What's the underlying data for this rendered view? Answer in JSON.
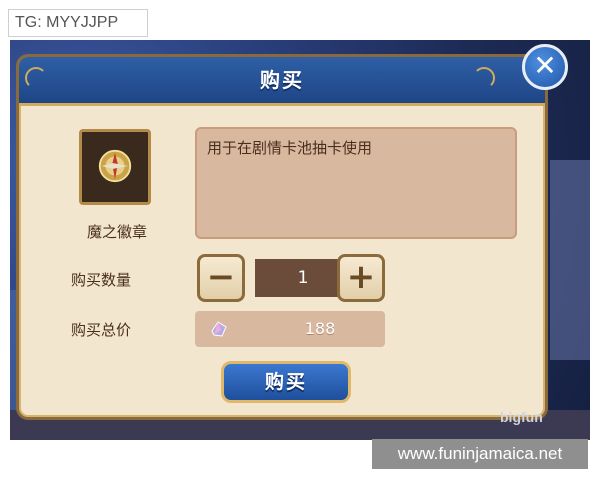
{
  "overlay": {
    "tg_label": "TG: MYYJJPP"
  },
  "dialog": {
    "title": "购买",
    "item": {
      "name": "魔之徽章",
      "description": "用于在剧情卡池抽卡使用",
      "icon": "badge-icon"
    },
    "quantity": {
      "label": "购买数量",
      "value": "1",
      "minus": "−",
      "plus": "+"
    },
    "price": {
      "label": "购买总价",
      "value": "188",
      "icon": "crystal-gem-icon"
    },
    "buy_button": "购买",
    "close_glyph": "✕"
  },
  "watermark": {
    "logo": "bigfun",
    "site": "www.funinjamaica.net"
  },
  "colors": {
    "header_blue": "#2f5fa6",
    "panel_bg": "#f3e6cf",
    "gold_trim": "#d2ac5c",
    "text_brown": "#4a2f1c"
  }
}
